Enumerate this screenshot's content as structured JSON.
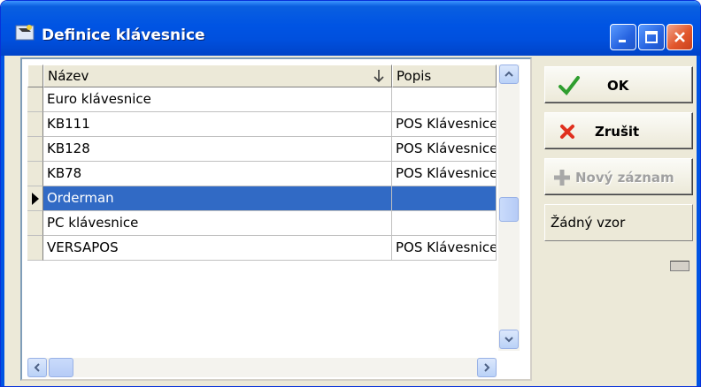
{
  "window": {
    "title": "Definice klávesnice"
  },
  "grid": {
    "columns": [
      "Název",
      "Popis"
    ],
    "rows": [
      {
        "name": "Euro klávesnice",
        "desc": ""
      },
      {
        "name": "KB111",
        "desc": "POS Klávesnice"
      },
      {
        "name": "KB128",
        "desc": "POS Klávesnice"
      },
      {
        "name": "KB78",
        "desc": "POS Klávesnice"
      },
      {
        "name": "Orderman",
        "desc": "",
        "selected": true
      },
      {
        "name": "PC klávesnice",
        "desc": ""
      },
      {
        "name": "VERSAPOS",
        "desc": "POS Klávesnice"
      }
    ]
  },
  "buttons": {
    "ok": "OK",
    "cancel": "Zrušit",
    "new_record": "Nový záznam",
    "no_template": "Žádný vzor"
  },
  "colors": {
    "selection": "#316ac5",
    "titlebar": "#0054e3",
    "ok_check": "#2f9e2f",
    "cancel_x": "#e0301e"
  }
}
